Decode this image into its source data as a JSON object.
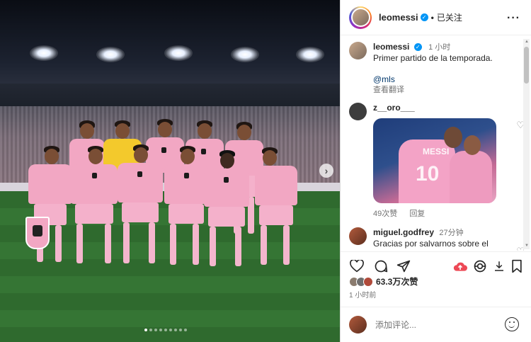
{
  "post": {
    "author": "leomessi",
    "follow_label": "已关注",
    "more_icon": "more-horizontal-icon",
    "caption_time": "1 小时",
    "caption_text": "Primer partido de la temporada.",
    "mention": "@mls",
    "translate_label": "查看翻译"
  },
  "comments": [
    {
      "user": "z__oro___",
      "likes": "49次赞",
      "reply_label": "回复"
    },
    {
      "user": "miguel.godfrey",
      "time": "27分钟",
      "text": "Gracias por salvarnos sobre el"
    }
  ],
  "gif": {
    "name_text": "MESSI",
    "number_text": "10"
  },
  "actions": {
    "like_icon": "heart-icon",
    "comment_icon": "comment-icon",
    "share_icon": "send-icon",
    "boost_icon": "cloud-upload-icon",
    "threads_icon": "threads-icon",
    "download_icon": "download-icon",
    "save_icon": "bookmark-icon"
  },
  "likes": {
    "count": "63.3万次赞"
  },
  "timestamp": "1 小时前",
  "add_comment": {
    "placeholder": "添加评论..."
  },
  "carousel": {
    "total": 9,
    "active_index": 1
  },
  "colors": {
    "verified": "#0095f6",
    "boost": "#ed4956",
    "jersey": "#f2a7c3",
    "gk_jersey": "#f3c92c"
  }
}
